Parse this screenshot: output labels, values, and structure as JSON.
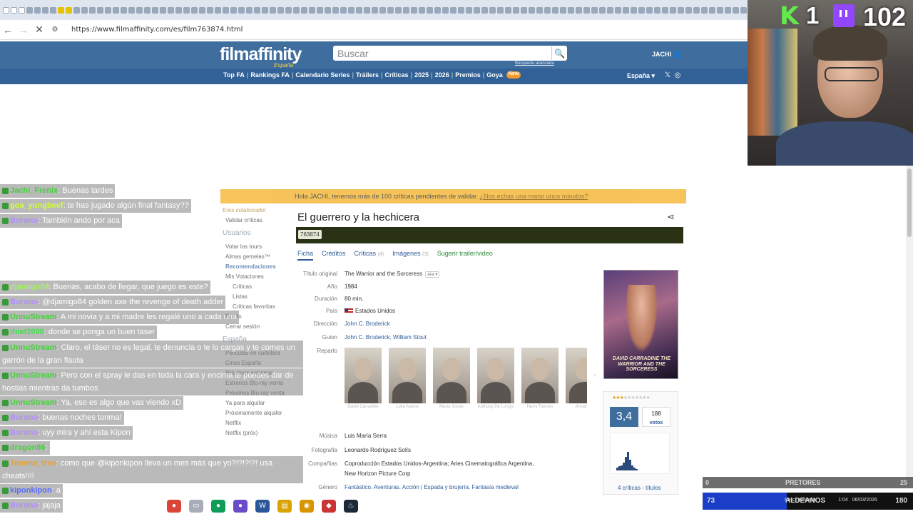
{
  "browser": {
    "url": "https://www.filmaffinity.com/es/film763874.html"
  },
  "header": {
    "logo_main": "filmaffinity",
    "logo_sub": "España",
    "search_placeholder": "Buscar",
    "advanced_search": "Búsqueda avanzada",
    "user": "JACHI",
    "nav": [
      "Top FA",
      "Rankings FA",
      "Calendario Series",
      "Tráilers",
      "Críticas",
      "2025",
      "2026",
      "Premios",
      "Goya"
    ],
    "new_badge": "New",
    "region": "España"
  },
  "notice": {
    "text": "Hola JACHI, tenemos más de 100 críticas pendientes de validar.",
    "link": "¿Nos echas una mano unos minutos?"
  },
  "sidebar": {
    "collab": "Eres colaborador",
    "validate": "Validar críticas",
    "users_heading": "Usuarios",
    "users_items": [
      "Votar los tours",
      "Almas gemelas™",
      "Recomendaciones",
      "Mis Votaciones",
      "Críticas",
      "Listas",
      "Críticas favoritas",
      "Buzón",
      "Cerrar sesión"
    ],
    "spain_heading": "España",
    "spain_items": [
      "Películas en cartelera",
      "Cines España",
      "Próximos estrenos",
      "Estrenos Blu-ray venta",
      "Próximos Blu-ray venta",
      "Ya para alquilar",
      "Próximamente alquiler",
      "Netflix",
      "Netflix (próx)"
    ]
  },
  "film": {
    "title": "El guerrero y la hechicera",
    "id": "763874",
    "tabs": [
      {
        "label": "Ficha",
        "count": ""
      },
      {
        "label": "Créditos",
        "count": ""
      },
      {
        "label": "Críticas",
        "count": "(4)"
      },
      {
        "label": "Imágenes",
        "count": "(3)"
      },
      {
        "label": "Sugerir trailer/video",
        "count": ""
      }
    ],
    "labels": {
      "original_title": "Título original",
      "year": "Año",
      "duration": "Duración",
      "country": "País",
      "director": "Dirección",
      "script": "Guion",
      "cast": "Reparto",
      "music": "Música",
      "photo": "Fotografía",
      "companies": "Compañías",
      "genre": "Género"
    },
    "original_title": "The Warrior and the Sorceress",
    "aka": "aka",
    "year": "1984",
    "duration": "80 min.",
    "country": "Estados Unidos",
    "director": "John C. Broderick",
    "script": "John C. Broderick, William Stout",
    "cast": [
      "David Carradine",
      "Luke Askew",
      "María Socas",
      "Anthony De Longis",
      "Harry Townes",
      "Armando"
    ],
    "music": "Luis María Serra",
    "photo": "Leonardo Rodríguez Solís",
    "companies_line1": "Coproducción Estados Unidos-Argentina; Aries Cinematográfica Argentina,",
    "companies_line2": "New Horizon Picture Corp",
    "genre": "Fantástico. Aventuras. Acción | Espada y brujería. Fantasía medieval",
    "poster_caption": "DAVID CARRADINE THE WARRIOR AND THE SORCERESS"
  },
  "rating": {
    "score": "3,4",
    "stars_filled": 3,
    "stars_total": 10,
    "votes": "188",
    "votes_label": "votos",
    "critics": "4 críticas - títulos",
    "histogram": [
      2,
      3,
      4,
      6,
      10,
      14,
      8,
      4,
      2,
      1
    ]
  },
  "chat": [
    {
      "user": "Jachi_Frenix",
      "color": "#44d13a",
      "msg": "Buenas tardes"
    },
    {
      "user": "goa_yungbeef",
      "color": "#d1ff3a",
      "msg": "te has jugado algún final fantasy??"
    },
    {
      "user": "Borono",
      "color": "#b38cff",
      "msg": "También ando por aca"
    },
    {
      "user": "djamigo84",
      "color": "#a2f560",
      "msg": "Buenas, acabo de llegar, que juego es este?"
    },
    {
      "user": "Borono",
      "color": "#b38cff",
      "msg": "@djamigo84 golden axe the revenge of death adder"
    },
    {
      "user": "UnnuStream",
      "color": "#44d13a",
      "msg": "A mi novia y a mi madre les regalé uno a cada una"
    },
    {
      "user": "thief2000",
      "color": "#41e04b",
      "msg": "donde se ponga un buen taser"
    },
    {
      "user": "UnnuStream",
      "color": "#44d13a",
      "msg": "Claro, el táser no es legal, te denuncia o te lo cargas y te comes un garrón de la gran flauta"
    },
    {
      "user": "UnnuStream",
      "color": "#44d13a",
      "msg": "Pero con el spray le das en toda la cara y encima le puedes dar de hostias mientras da tumbos"
    },
    {
      "user": "UnnuStream",
      "color": "#44d13a",
      "msg": "Ya, eso es algo que vas viendo xD"
    },
    {
      "user": "Borono",
      "color": "#b38cff",
      "msg": "buenas noches tonma!"
    },
    {
      "user": "Borono",
      "color": "#b38cff",
      "msg": "uyy mira y ahí esta Kipon"
    },
    {
      "user": "dragon86",
      "color": "#44d13a",
      "msg": ""
    },
    {
      "user": "Tomma_tres",
      "color": "#e2a23a",
      "msg": "como que @kiponkipon lleva un mes más que yo?!?!?!?! usa cheats!!!!"
    },
    {
      "user": "kiponkipon",
      "color": "#5a6bff",
      "msg": "a"
    },
    {
      "user": "Borono",
      "color": "#b38cff",
      "msg": "jajaja"
    }
  ],
  "stream": {
    "k_label": "K",
    "k_count": "1",
    "viewer_count": "102",
    "team1_name": "PRETORES",
    "team1_left": "0",
    "team1_right": "25",
    "team2_name": "ALDEANOS",
    "team2_left": "73",
    "team2_right": "180",
    "team2_fill": 0.4,
    "tray_weather": "Parc. nublado",
    "tray_time": "1:04",
    "tray_date": "06/03/2026"
  },
  "colors": {
    "header_bg": "#3e6d9e",
    "nav_bg": "#316196",
    "notice_bg": "#f5b532",
    "id_bar_bg": "#2a3216",
    "link_blue": "#2c5c99",
    "team_fill": "#1a3ec8",
    "k_green": "#63e84e",
    "twitch_purple": "#9146ff"
  }
}
